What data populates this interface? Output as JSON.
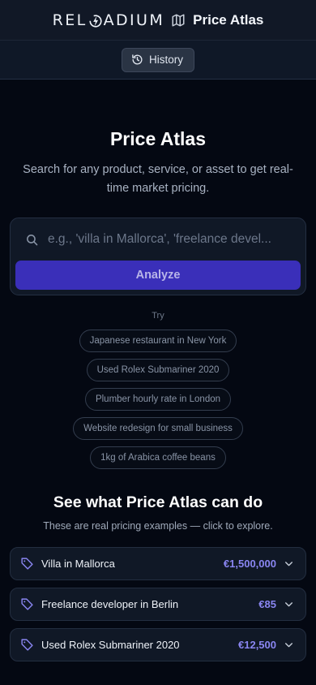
{
  "header": {
    "brand": {
      "part1": "REL",
      "part2": "ADIUM"
    },
    "app_title": "Price Atlas"
  },
  "toolbar": {
    "history_label": "History"
  },
  "hero": {
    "title": "Price Atlas",
    "subtitle": "Search for any product, service, or asset to get real-time market pricing."
  },
  "search": {
    "value": "",
    "placeholder": "e.g., 'villa in Mallorca', 'freelance devel...",
    "analyze_label": "Analyze"
  },
  "suggestions": {
    "label": "Try",
    "items": [
      "Japanese restaurant in New York",
      "Used Rolex Submariner 2020",
      "Plumber hourly rate in London",
      "Website redesign for small business",
      "1kg of Arabica coffee beans"
    ]
  },
  "examples": {
    "title": "See what Price Atlas can do",
    "subtitle": "These are real pricing examples — click to explore.",
    "items": [
      {
        "label": "Villa in Mallorca",
        "price": "€1,500,000",
        "icon": "tag-icon"
      },
      {
        "label": "Freelance developer in Berlin",
        "price": "€85",
        "icon": "tag-icon"
      },
      {
        "label": "Used Rolex Submariner 2020",
        "price": "€12,500",
        "icon": "tag-icon"
      }
    ]
  },
  "colors": {
    "background": "#040812",
    "accent": "#3a2fb9",
    "price": "#8a86f2"
  }
}
